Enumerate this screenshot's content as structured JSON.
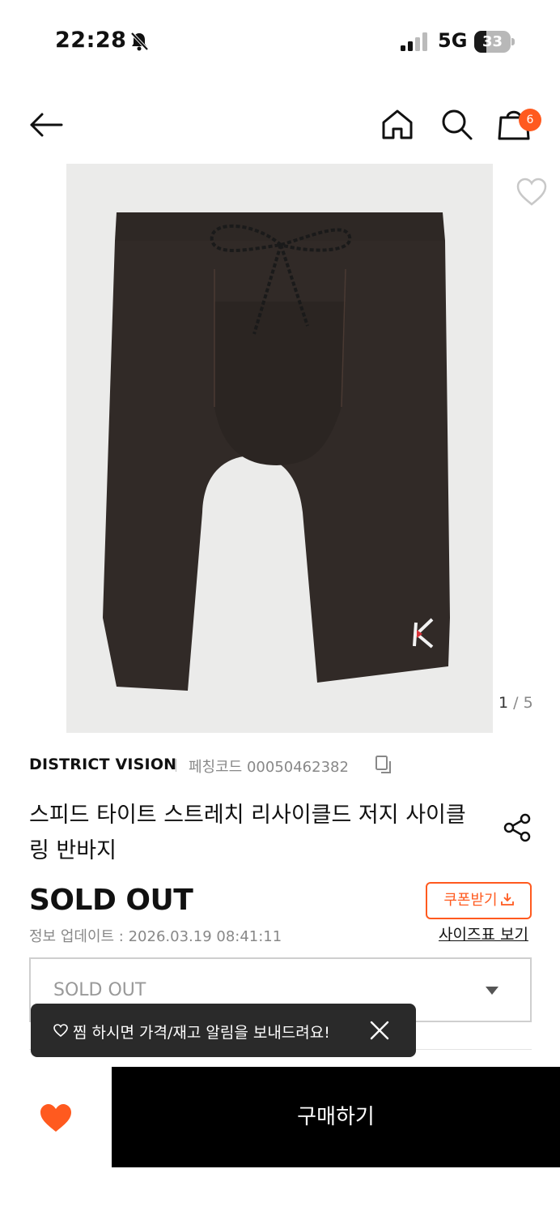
{
  "status_bar": {
    "time": "22:28",
    "network": "5G",
    "battery_level": "33",
    "battery_fraction": 0.33
  },
  "header": {
    "icons": [
      "back-arrow-icon",
      "home-icon",
      "search-icon",
      "shopping-bag-icon"
    ],
    "cart_count": "6"
  },
  "gallery": {
    "current": "1",
    "separator": " / ",
    "total": "5"
  },
  "product": {
    "brand": "DISTRICT VISION",
    "code_label": "페칭코드 00050462382",
    "title": "스피드 타이트 스트레치 리사이클드 저지 사이클링 반바지",
    "price": "SOLD OUT",
    "update_info": "정보 업데이트 : 2026.03.19 08:41:11"
  },
  "actions": {
    "coupon": "쿠폰받기",
    "size_chart": "사이즈표 보기",
    "option_select": "SOLD OUT",
    "buy": "구매하기"
  },
  "toast": {
    "message": "찜 하시면 가격/재고 알림을 보내드려요!"
  },
  "colors": {
    "accent": "#ff5a1f",
    "buy_button": "#000000",
    "toast_bg": "#2a2a2a"
  }
}
